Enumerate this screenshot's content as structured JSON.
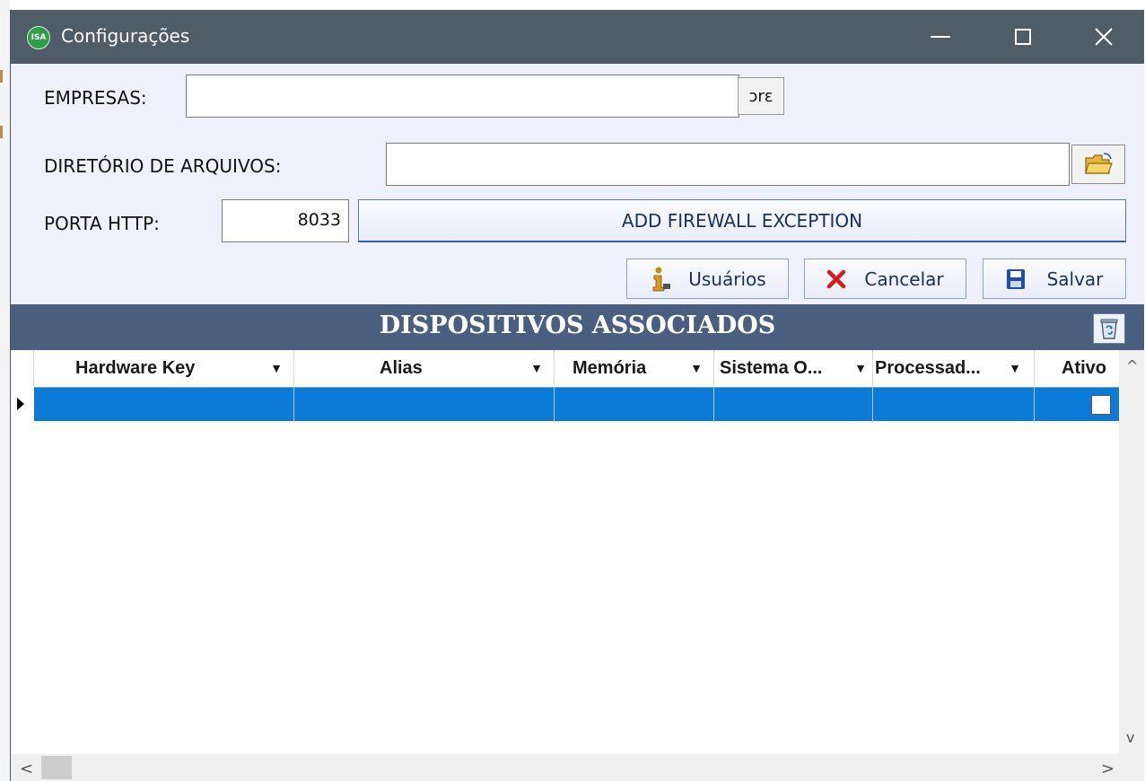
{
  "window": {
    "title": "Configurações",
    "icon_label": "ISA",
    "controls": {
      "minimize": "minimize-icon",
      "maximize": "maximize-icon",
      "close": "close-icon"
    }
  },
  "form": {
    "empresas_label": "EMPRESAS:",
    "empresas_value": "",
    "empresas_button_text": "ɔrɛ",
    "diretorio_label": "DIRETÓRIO DE ARQUIVOS:",
    "diretorio_value": "",
    "porta_label": "PORTA HTTP:",
    "porta_value": "8033",
    "firewall_button": "ADD FIREWALL EXCEPTION"
  },
  "toolbar": {
    "usuarios": "Usuários",
    "cancelar": "Cancelar",
    "salvar": "Salvar"
  },
  "devices": {
    "title": "DISPOSITIVOS ASSOCIADOS",
    "columns": [
      "Hardware Key",
      "Alias",
      "Memória",
      "Sistema O...",
      "Processad...",
      "Ativo"
    ],
    "rows": [
      {
        "hardware_key": "",
        "alias": "",
        "memoria": "",
        "sistema": "",
        "processador": "",
        "ativo": false
      }
    ]
  },
  "colors": {
    "titlebar": "#4f5d69",
    "window_bg": "#eef1fb",
    "band": "#4a5f80",
    "selected_row": "#0c7ad7",
    "button_text": "#17305f"
  }
}
